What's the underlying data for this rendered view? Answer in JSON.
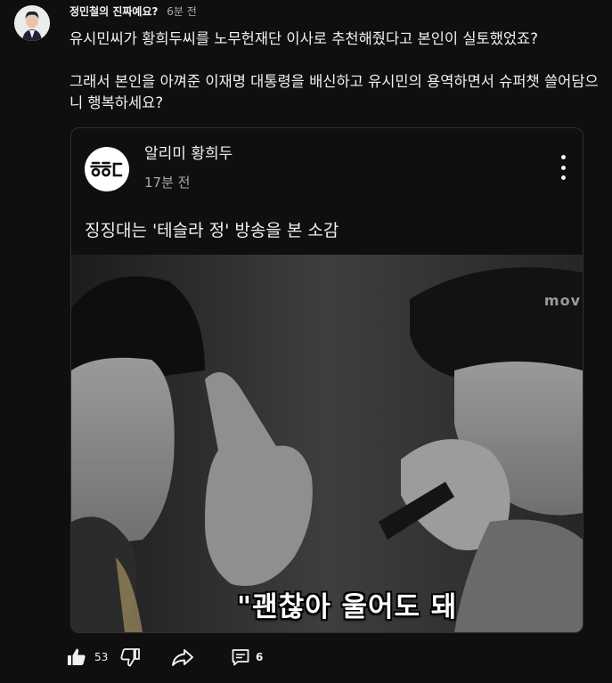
{
  "comment": {
    "author": "정민철의 진짜예요?",
    "timestamp": "6분 전",
    "paragraphs": [
      "유시민씨가 황희두씨를 노무헌재단 이사로 추천해줬다고 본인이 실토했었죠?",
      "그래서 본인을 아껴준 이재명 대통령을 배신하고 유시민의 용역하면서 슈퍼챗 쓸어담으니 행복하세요?"
    ]
  },
  "post": {
    "channel_name": "알리미 황희두",
    "logo_text": "ᄒᄒᄃ",
    "time": "17분 전",
    "title": "징징대는 '테슬라 정' 방송을 본 소감",
    "image_watermark": "mov",
    "image_subtitle": "\"괜찮아 울어도 돼"
  },
  "actions": {
    "like_count": "53",
    "reply_count": "6"
  },
  "icons": {
    "like": "thumbs-up-icon",
    "dislike": "thumbs-down-icon",
    "share": "share-arrow-icon",
    "reply": "comment-bubble-icon",
    "menu": "more-vertical-icon"
  },
  "colors": {
    "background": "#0f0f0f",
    "text": "#f1f1f1",
    "secondary_text": "#aaaaaa",
    "card_border": "#303030"
  }
}
